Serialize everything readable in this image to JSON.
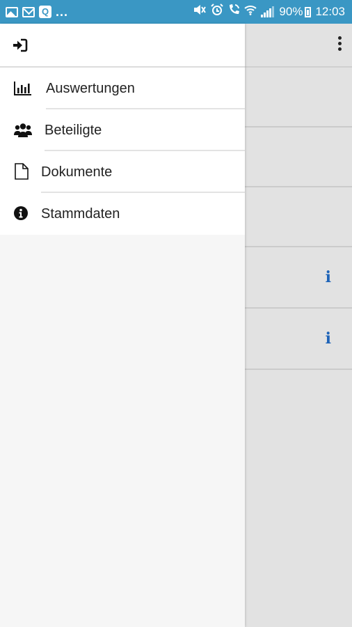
{
  "status_bar": {
    "left_icons": [
      "gallery-icon",
      "mail-icon",
      "q-app-icon"
    ],
    "ellipsis": "...",
    "battery_text": "90%",
    "time": "12:03",
    "right_icons": [
      "mute-icon",
      "alarm-icon",
      "wifi-call-icon",
      "wifi-icon",
      "signal-icon",
      "battery-icon"
    ]
  },
  "drawer": {
    "header_icon": "logout-icon",
    "items": [
      {
        "label": "Auswertungen",
        "icon": "bar-chart-icon"
      },
      {
        "label": "Beteiligte",
        "icon": "users-icon"
      },
      {
        "label": "Dokumente",
        "icon": "document-icon"
      },
      {
        "label": "Stammdaten",
        "icon": "info-circle-icon"
      }
    ]
  },
  "background": {
    "overflow_icon": "more-vertical-icon",
    "info_icon_glyph": "i"
  },
  "colors": {
    "status_bar": "#3a97c4",
    "info_icon": "#1f64b8",
    "drawer_bg": "#f6f6f6"
  }
}
